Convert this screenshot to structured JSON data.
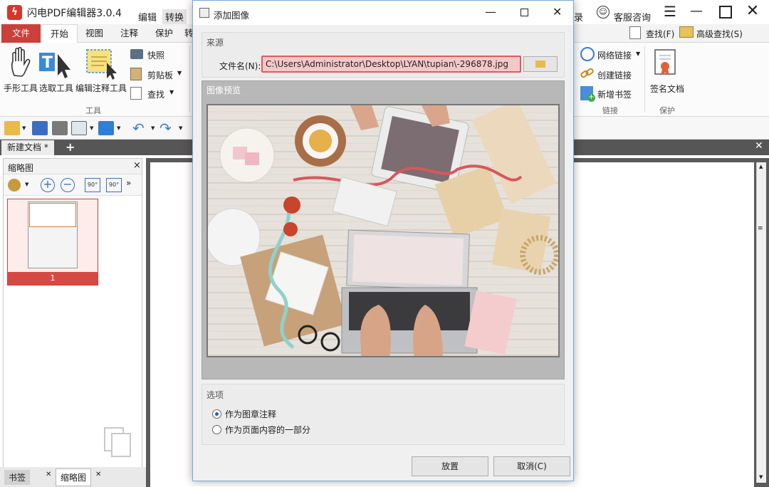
{
  "app": {
    "logo_glyph": "ϟ",
    "title": "闪电PDF编辑器3.0.4"
  },
  "top_menu": {
    "edit": "编辑",
    "convert": "转换",
    "record_partial": "录",
    "support": "客服咨询"
  },
  "ribbon_tabs": {
    "file": "文件",
    "home": "开始",
    "view": "视图",
    "annotate": "注释",
    "protect": "保护",
    "more_partial": "转"
  },
  "ribbon": {
    "hand_tool": "手形工具",
    "select_text": "选取工具",
    "edit_annot": "编辑注释工具",
    "tools_group": "工具",
    "snapshot": "快照",
    "clipboard": "剪贴板",
    "find_small": "查找",
    "find": "查找(F)",
    "advanced_find": "高级查找(S)",
    "web_link": "网络链接",
    "create_link": "创建链接",
    "new_bookmark": "新增书签",
    "links_group": "链接",
    "sign_doc": "签名文档",
    "protect_group": "保护"
  },
  "doc_tab": {
    "label": "新建文档 *",
    "add": "+"
  },
  "left_panel": {
    "title": "缩略图",
    "close": "×",
    "page_number": "1",
    "bottom_tabs": [
      "书签",
      "缩略图"
    ]
  },
  "dialog": {
    "title": "添加图像",
    "source_header": "来源",
    "file_label": "文件名(N):",
    "file_value": "C:\\Users\\Administrator\\Desktop\\LYAN\\tupian\\-296878.jpg",
    "preview_header": "图像预览",
    "options_header": "选项",
    "option_stamp": "作为图章注释",
    "option_page_content": "作为页面内容的一部分",
    "place_button": "放置",
    "cancel_button": "取消(C)",
    "selected_option": "作为图章注释"
  },
  "colors": {
    "accent_red": "#c9413a",
    "dialog_border": "#7aa7d8",
    "file_field_border": "#e05a5a",
    "file_field_bg": "#f5c8c8"
  }
}
